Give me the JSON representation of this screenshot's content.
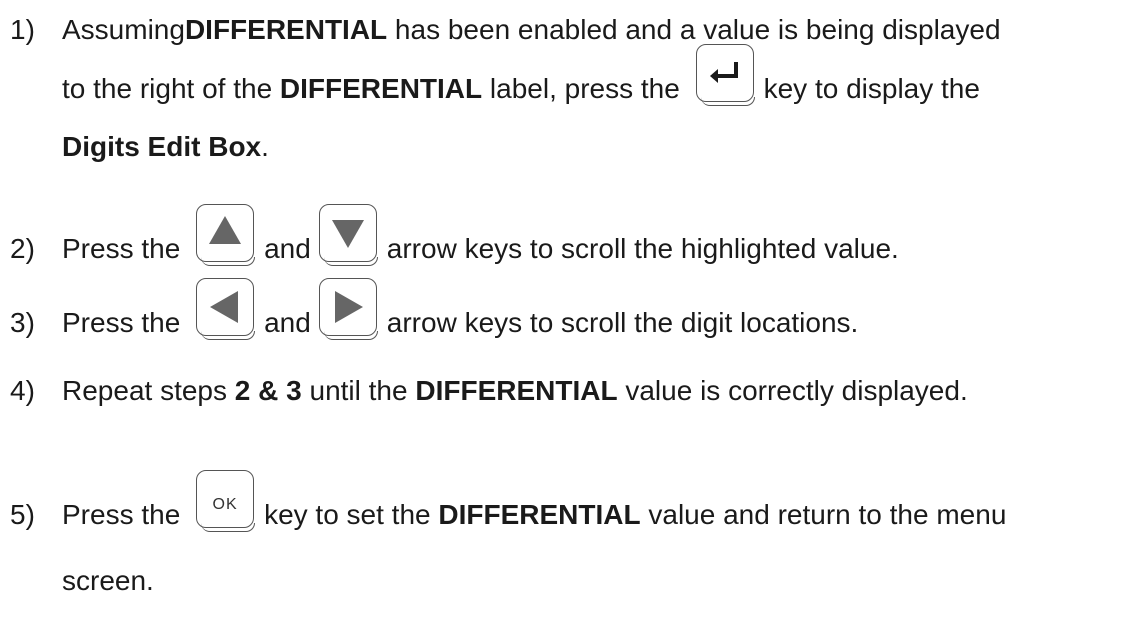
{
  "steps": [
    {
      "number": "1)",
      "line1": {
        "a": "Assuming ",
        "b": "DIFFERENTIAL",
        "c": " has been enabled and a value is being displayed"
      },
      "line2": {
        "a": "to the right of the ",
        "b": "DIFFERENTIAL",
        "c": " label, press the ",
        "d": "key to display the"
      },
      "line3": {
        "b": "Digits Edit Box",
        "c": "."
      },
      "key": "enter-key"
    },
    {
      "number": "2)",
      "a": "Press the ",
      "mid": "and",
      "c": "arrow keys to scroll the highlighted value.",
      "keys": [
        "up-arrow-key",
        "down-arrow-key"
      ]
    },
    {
      "number": "3)",
      "a": "Press the ",
      "mid": "and",
      "c": "arrow keys to scroll the digit locations.",
      "keys": [
        "left-arrow-key",
        "right-arrow-key"
      ]
    },
    {
      "number": "4)",
      "a": "Repeat steps ",
      "b": "2 & 3",
      "c": " until the ",
      "d": "DIFFERENTIAL",
      "e": " value is correctly displayed."
    },
    {
      "number": "5)",
      "a": "Press the ",
      "key_label": "OK",
      "c": "key to set the ",
      "d": "DIFFERENTIAL",
      "e": " value and return to the menu",
      "line2": "screen."
    }
  ]
}
